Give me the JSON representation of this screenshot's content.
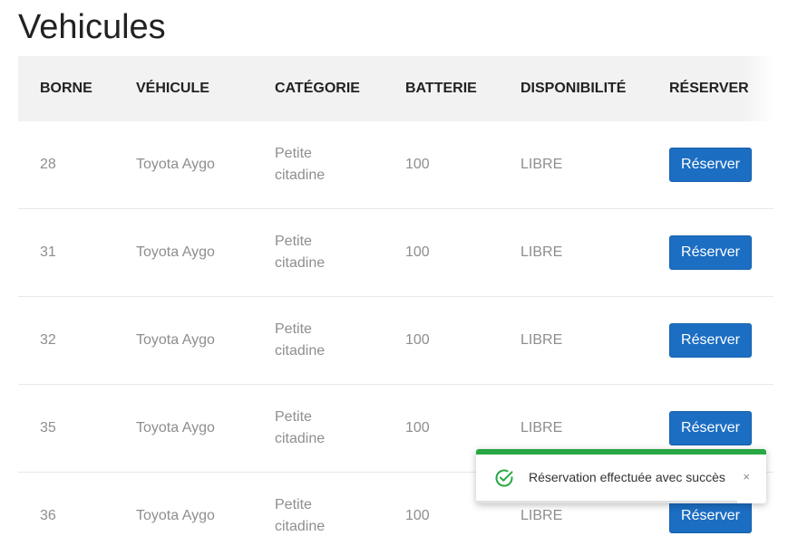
{
  "page": {
    "title": "Vehicules"
  },
  "table": {
    "headers": {
      "borne": "BORNE",
      "vehicule": "VÉHICULE",
      "categorie": "CATÉGORIE",
      "batterie": "BATTERIE",
      "disponibilite": "DISPONIBILITÉ",
      "reserver": "RÉSERVER"
    },
    "rows": [
      {
        "borne": "28",
        "vehicule": "Toyota Aygo",
        "categorie_line1": "Petite",
        "categorie_line2": "citadine",
        "batterie": "100",
        "disponibilite": "LIBRE",
        "action": "Réserver"
      },
      {
        "borne": "31",
        "vehicule": "Toyota Aygo",
        "categorie_line1": "Petite",
        "categorie_line2": "citadine",
        "batterie": "100",
        "disponibilite": "LIBRE",
        "action": "Réserver"
      },
      {
        "borne": "32",
        "vehicule": "Toyota Aygo",
        "categorie_line1": "Petite",
        "categorie_line2": "citadine",
        "batterie": "100",
        "disponibilite": "LIBRE",
        "action": "Réserver"
      },
      {
        "borne": "35",
        "vehicule": "Toyota Aygo",
        "categorie_line1": "Petite",
        "categorie_line2": "citadine",
        "batterie": "100",
        "disponibilite": "LIBRE",
        "action": "Réserver"
      },
      {
        "borne": "36",
        "vehicule": "Toyota Aygo",
        "categorie_line1": "Petite",
        "categorie_line2": "citadine",
        "batterie": "100",
        "disponibilite": "LIBRE",
        "action": "Réserver"
      }
    ]
  },
  "toast": {
    "message": "Réservation effectuée avec succès",
    "close": "×",
    "icon": "check-circle-icon",
    "accent_color": "#28a745",
    "progress_remaining": 0.9
  },
  "colors": {
    "button": "#1b6ec2",
    "header_bg": "#f2f2f2",
    "cell_text": "#8e8e8e"
  }
}
